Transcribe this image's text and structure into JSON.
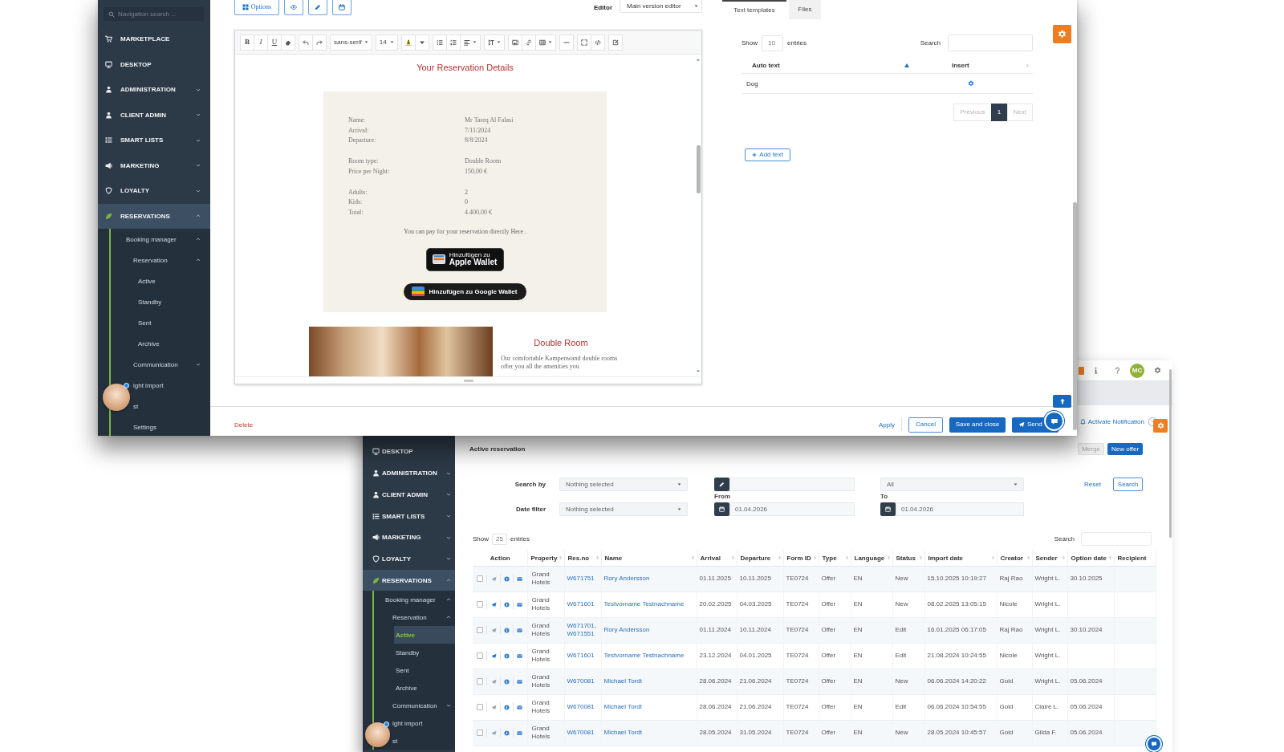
{
  "editor_window": {
    "sidebar": {
      "search": {
        "placeholder": "Navigation search ..."
      },
      "items": [
        {
          "label": "MARKETPLACE",
          "selected": false
        },
        {
          "label": "DESKTOP",
          "selected": false
        },
        {
          "label": "ADMINISTRATION",
          "selected": false,
          "expanded": false
        },
        {
          "label": "CLIENT ADMIN",
          "selected": false,
          "expanded": false
        },
        {
          "label": "SMART LISTS",
          "selected": false,
          "expanded": false
        },
        {
          "label": "MARKETING",
          "selected": false,
          "expanded": false
        },
        {
          "label": "LOYALTY",
          "selected": false,
          "expanded": false
        },
        {
          "label": "RESERVATIONS",
          "selected": true,
          "expanded": true,
          "children": [
            {
              "label": "Booking manager",
              "selected": false,
              "expanded": true,
              "children": [
                {
                  "label": "Reservation",
                  "selected": false,
                  "expanded": true,
                  "children": [
                    {
                      "label": "Active",
                      "selected": false
                    },
                    {
                      "label": "Standby",
                      "selected": false
                    },
                    {
                      "label": "Sent",
                      "selected": false
                    },
                    {
                      "label": "Archive",
                      "selected": false
                    }
                  ]
                },
                {
                  "label": "Communication",
                  "selected": false,
                  "expanded": false
                },
                {
                  "label": "ight import",
                  "selected": false
                },
                {
                  "label": "st",
                  "selected": false
                },
                {
                  "label": "Settings",
                  "selected": false
                }
              ]
            }
          ]
        }
      ]
    },
    "toolbar": {
      "options": "Options",
      "editor_label": "Editor",
      "editor_select": "Main version editor"
    },
    "format_bar": {
      "bold": "B",
      "italic": "I",
      "underline": "U",
      "font": "sans-serif",
      "size": "14"
    },
    "document": {
      "heading": "Your Reservation Details",
      "details": [
        [
          {
            "label": "Name:",
            "value": "Mr Tareq Al Falasi"
          },
          {
            "label": "Arrival:",
            "value": "7/11/2024"
          },
          {
            "label": "Departure:",
            "value": "8/8/2024"
          }
        ],
        [
          {
            "label": "Room type:",
            "value": "Double Room"
          },
          {
            "label": "Price per Night:",
            "value": "150,00 €"
          }
        ],
        [
          {
            "label": "Adults:",
            "value": "2"
          },
          {
            "label": "Kids:",
            "value": "0"
          },
          {
            "label": "Total:",
            "value": "4.400,00 €"
          }
        ]
      ],
      "pay_note": "You can pay for your reservation directly Here .",
      "apple_wallet": {
        "line1": "Hinzufügen zu",
        "line2": "Apple Wallet"
      },
      "google_wallet": "Hinzufügen zu Google Wallet",
      "room": {
        "title": "Double Room",
        "description": "Our comfortable Kampenwand double rooms offer you all the amenities you"
      }
    },
    "side_panel": {
      "tabs": [
        {
          "label": "Text templates",
          "selected": true
        },
        {
          "label": "Files",
          "selected": false
        }
      ],
      "show": {
        "before": "Show",
        "value": "10",
        "after": "entries"
      },
      "search_label": "Search",
      "columns": [
        "Auto text",
        "Insert"
      ],
      "rows": [
        {
          "auto_text": "Dog"
        }
      ],
      "pagination": {
        "previous": {
          "label": "Previous",
          "disabled": true
        },
        "pages": [
          {
            "label": "1",
            "selected": true
          }
        ],
        "next": {
          "label": "Next",
          "disabled": true
        }
      },
      "add_button": "Add text"
    },
    "footer": {
      "delete": "Delete",
      "apply": "Apply",
      "cancel": "Cancel",
      "save_close": "Save and close",
      "send": "Send"
    }
  },
  "list_window": {
    "header": {
      "avatar_initials": "MC",
      "notification_link": "Activate Notification"
    },
    "sidebar": {
      "items": [
        {
          "label": "DESKTOP",
          "selected": false
        },
        {
          "label": "ADMINISTRATION",
          "selected": false,
          "expanded": false
        },
        {
          "label": "CLIENT ADMIN",
          "selected": false,
          "expanded": false
        },
        {
          "label": "SMART LISTS",
          "selected": false,
          "expanded": false
        },
        {
          "label": "MARKETING",
          "selected": false,
          "expanded": false
        },
        {
          "label": "LOYALTY",
          "selected": false,
          "expanded": false
        },
        {
          "label": "RESERVATIONS",
          "selected": true,
          "expanded": true,
          "children": [
            {
              "label": "Booking manager",
              "selected": false,
              "expanded": true,
              "children": [
                {
                  "label": "Reservation",
                  "selected": false,
                  "expanded": true,
                  "children": [
                    {
                      "label": "Active",
                      "selected": true
                    },
                    {
                      "label": "Standby",
                      "selected": false
                    },
                    {
                      "label": "Sent",
                      "selected": false
                    },
                    {
                      "label": "Archive",
                      "selected": false
                    }
                  ]
                },
                {
                  "label": "Communication",
                  "selected": false,
                  "expanded": false
                },
                {
                  "label": "ight import",
                  "selected": false
                },
                {
                  "label": "st",
                  "selected": false
                }
              ]
            }
          ]
        }
      ]
    },
    "title": "Active reservation",
    "actions": {
      "merge": {
        "label": "Merge",
        "disabled": true
      },
      "new_offer": "New offer"
    },
    "filters": {
      "search_by_label": "Search by",
      "search_by": "Nothing selected",
      "all": "All",
      "date_filter_label": "Date filter",
      "date_filter": "Nothing selected",
      "from_label": "From",
      "from": "01.04.2026",
      "to_label": "To",
      "to": "01.04.2026",
      "reset": "Reset",
      "search": "Search"
    },
    "show": {
      "before": "Show",
      "value": "25",
      "after": "entries"
    },
    "search_label": "Search",
    "table": {
      "columns": [
        "Action",
        "Property",
        "Res.no",
        "Name",
        "Arrival",
        "Departure",
        "Form ID",
        "Type",
        "Language",
        "Status",
        "Import date",
        "Creator",
        "Sender",
        "Option date",
        "Recipient"
      ],
      "rows": [
        {
          "checked": false,
          "sent": false,
          "property": "Grand Hotels",
          "res_no": "W671751",
          "name": "Rory Andersson",
          "arrival": "01.11.2025",
          "departure": "10.11.2025",
          "form_id": "TE0724",
          "type": "Offer",
          "language": "EN",
          "status": "New",
          "import_date": "15.10.2025 10:19:27",
          "creator": "Raj Rao",
          "sender": "Wright L.",
          "option_date": "30.10.2025"
        },
        {
          "checked": false,
          "sent": true,
          "property": "Grand Hotels",
          "res_no": "W671601",
          "name": "Testvorname Testnachname",
          "arrival": "20.02.2025",
          "departure": "04.03.2025",
          "form_id": "TE0724",
          "type": "Offer",
          "language": "EN",
          "status": "New",
          "import_date": "08.02.2025 13:05:15",
          "creator": "Nicole",
          "sender": "Wright L."
        },
        {
          "checked": false,
          "sent": false,
          "property": "Grand Hotels",
          "res_no": "W671701, W671551",
          "name": "Rory Andersson",
          "arrival": "01.11.2024",
          "departure": "10.11.2024",
          "form_id": "TE0724",
          "type": "Offer",
          "language": "EN",
          "status": "Edit",
          "import_date": "16.01.2025 06:17:05",
          "creator": "Raj Rao",
          "sender": "Wright L.",
          "option_date": "30.10.2024"
        },
        {
          "checked": false,
          "sent": true,
          "property": "Grand Hotels",
          "res_no": "W671601",
          "name": "Testvorname Testnachname",
          "arrival": "23.12.2024",
          "departure": "04.01.2025",
          "form_id": "TE0724",
          "type": "Offer",
          "language": "EN",
          "status": "Edit",
          "import_date": "21.08.2024 10:24:55",
          "creator": "Nicole",
          "sender": "Wright L."
        },
        {
          "checked": false,
          "sent": false,
          "property": "Grand Hotels",
          "res_no": "W670081",
          "name": "Michael Tordt",
          "arrival": "28.06.2024",
          "departure": "21.06.2024",
          "form_id": "TE0724",
          "type": "Offer",
          "language": "EN",
          "status": "New",
          "import_date": "06.06.2024 14:20:22",
          "creator": "Gold",
          "sender": "Wright L.",
          "option_date": "05.06.2024"
        },
        {
          "checked": false,
          "sent": false,
          "property": "Grand Hotels",
          "res_no": "W670081",
          "name": "Michael Tordt",
          "arrival": "28.06.2024",
          "departure": "21.06.2024",
          "form_id": "TE0724",
          "type": "Offer",
          "language": "EN",
          "status": "Edit",
          "import_date": "06.06.2024 10:54:55",
          "creator": "Gold",
          "sender": "Claire L.",
          "option_date": "05.06.2024"
        },
        {
          "checked": false,
          "sent": false,
          "property": "Grand Hotels",
          "res_no": "W670081",
          "name": "Michael Tordt",
          "arrival": "28.05.2024",
          "departure": "31.05.2024",
          "form_id": "TE0724",
          "type": "Offer",
          "language": "EN",
          "status": "New",
          "import_date": "28.05.2024 10:45:57",
          "creator": "Gold",
          "sender": "Gilda F.",
          "option_date": "05.06.2024"
        }
      ]
    }
  }
}
